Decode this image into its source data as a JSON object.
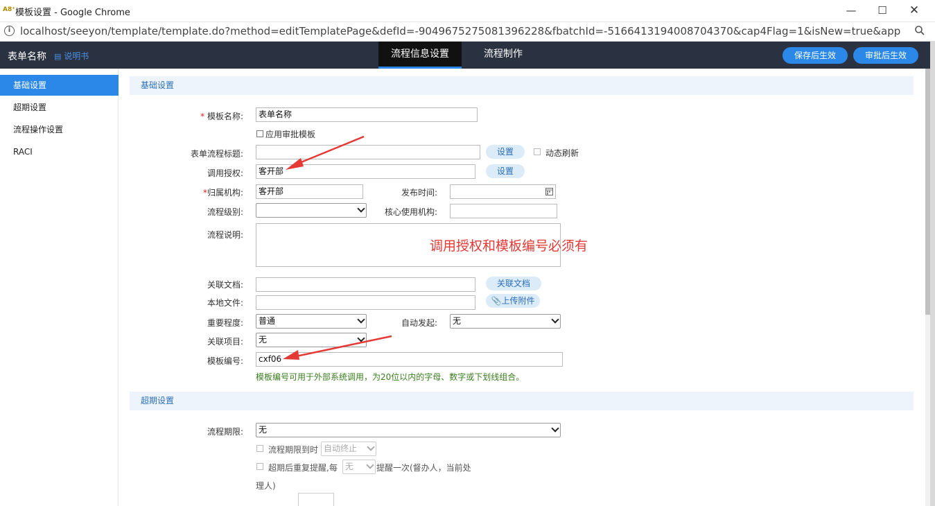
{
  "window": {
    "app_icon": "A8⁺",
    "title": "模板设置 - Google Chrome",
    "url": "localhost/seeyon/template/template.do?method=editTemplatePage&defId=-9049675275081396228&fbatchId=-5166413194008704370&cap4Flag=1&isNew=true&app="
  },
  "header": {
    "form_name": "表单名称",
    "manual_link": "说明书",
    "tabs": [
      {
        "label": "流程信息设置",
        "active": true
      },
      {
        "label": "流程制作",
        "active": false
      }
    ],
    "save_btn": "保存后生效",
    "approve_btn": "审批后生效",
    "accent": "#2b88e8"
  },
  "sidebar": {
    "items": [
      {
        "label": "基础设置",
        "active": true
      },
      {
        "label": "超期设置",
        "active": false
      },
      {
        "label": "流程操作设置",
        "active": false
      },
      {
        "label": "RACI",
        "active": false
      }
    ]
  },
  "basic": {
    "section_title": "基础设置",
    "template_name_label": "模板名称:",
    "template_name_value": "表单名称",
    "use_approval_template": "应用审批模板",
    "flow_title_label": "表单流程标题:",
    "flow_title_value": "",
    "set_btn": "设置",
    "dynamic_refresh": "动态刷新",
    "auth_label": "调用授权:",
    "auth_value": "客开部",
    "org_label": "归属机构:",
    "org_value": "客开部",
    "publish_time_label": "发布时间:",
    "publish_time_value": "",
    "flow_level_label": "流程级别:",
    "flow_level_value": "",
    "core_org_label": "核心使用机构:",
    "core_org_value": "",
    "desc_label": "流程说明:",
    "desc_value": "",
    "related_doc_label": "关联文档:",
    "related_doc_btn": "关联文档",
    "local_file_label": "本地文件:",
    "upload_btn": "上传附件",
    "importance_label": "重要程度:",
    "importance_value": "普通",
    "auto_start_label": "自动发起:",
    "auto_start_value": "无",
    "related_item_label": "关联项目:",
    "related_item_value": "无",
    "template_no_label": "模板编号:",
    "template_no_value": "cxf06",
    "template_no_hint": "模板编号可用于外部系统调用，为20位以内的字母、数字或下划线组合。"
  },
  "overdue": {
    "section_title": "超期设置",
    "deadline_label": "流程期限:",
    "deadline_value": "无",
    "on_deadline": "流程期限到时",
    "on_deadline_action": "自动终止",
    "repeat_remind_prefix": "超期后重复提醒,每",
    "repeat_interval": "无",
    "repeat_remind_suffix": "提醒一次(督办人，当前处",
    "repeat_remind_suffix2": "理人)"
  },
  "annotation": {
    "text": "调用授权和模板编号必须有",
    "color": "#e53935"
  }
}
